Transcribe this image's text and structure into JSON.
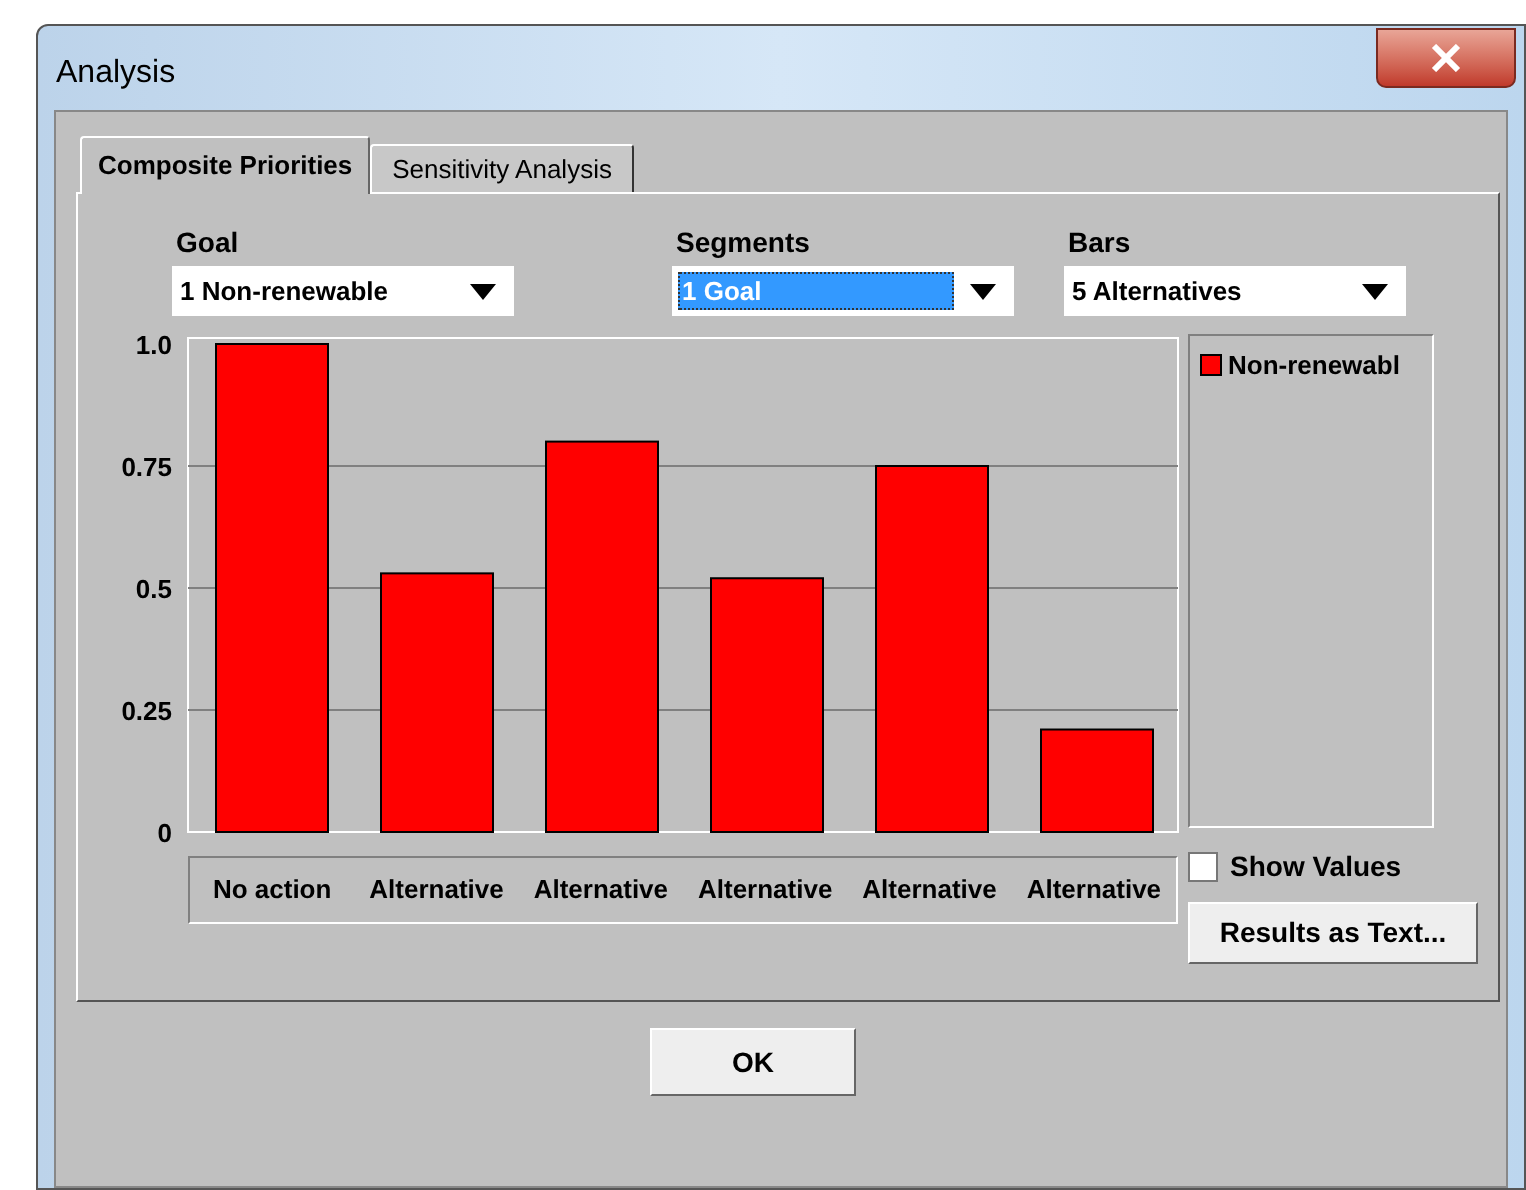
{
  "window": {
    "title": "Analysis"
  },
  "tabs": [
    {
      "label": "Composite Priorities",
      "selected": true
    },
    {
      "label": "Sensitivity Analysis",
      "selected": false
    }
  ],
  "selectors": [
    {
      "label": "Goal",
      "value": "1 Non-renewable",
      "focused": false
    },
    {
      "label": "Segments",
      "value": "1 Goal",
      "focused": true
    },
    {
      "label": "Bars",
      "value": "5 Alternatives",
      "focused": false
    }
  ],
  "chart_data": {
    "type": "bar",
    "categories": [
      "No action",
      "Alternative",
      "Alternative",
      "Alternative",
      "Alternative",
      "Alternative"
    ],
    "series": [
      {
        "name": "Non-renewabl",
        "color": "#ff0000",
        "values": [
          1.0,
          0.53,
          0.8,
          0.52,
          0.75,
          0.21
        ]
      }
    ],
    "grid": true,
    "ylim": [
      0,
      1
    ],
    "yticks": [
      0,
      {
        "value": 0.25,
        "label": "0.25"
      },
      {
        "value": 0.5,
        "label": "0.5"
      },
      {
        "value": 0.75,
        "label": "0.75"
      },
      {
        "value": 1,
        "label": "1.0"
      }
    ]
  },
  "show_values": {
    "label": "Show Values",
    "checked": false
  },
  "results_button": "Results as Text...",
  "ok_button": "OK"
}
